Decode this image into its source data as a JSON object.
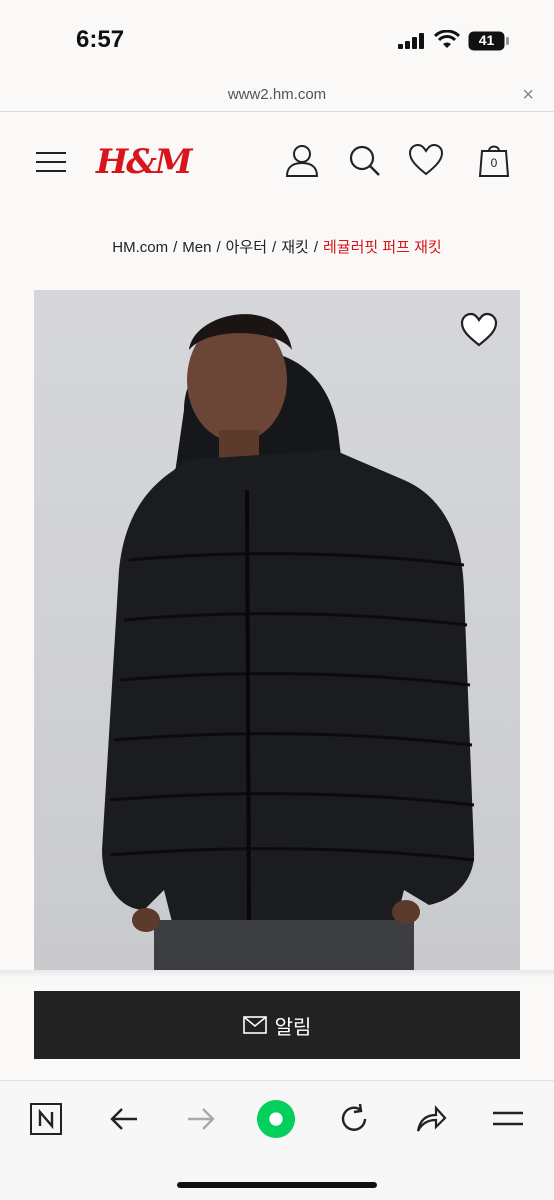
{
  "status": {
    "time": "6:57",
    "battery": "41"
  },
  "browser": {
    "url": "www2.hm.com",
    "close_glyph": "×"
  },
  "header": {
    "logo": "H&M",
    "cart_count": "0"
  },
  "breadcrumb": {
    "items": [
      "HM.com",
      "Men",
      "아우터",
      "재킷"
    ],
    "separator": "/",
    "current": "레귤러핏 퍼프 재킷"
  },
  "product": {
    "image_alt": "black hooded puffer jacket",
    "favorite_icon": "heart-icon"
  },
  "notify": {
    "label": "알림",
    "icon": "mail-icon"
  },
  "toolbar": {
    "icons": [
      "naver-n-icon",
      "back-arrow-icon",
      "forward-arrow-icon",
      "green-home-dot-icon",
      "reload-icon",
      "share-icon",
      "menu-icon"
    ]
  },
  "colors": {
    "brand_red": "#d8141c",
    "button_dark": "#222222",
    "green": "#03cf5d"
  }
}
